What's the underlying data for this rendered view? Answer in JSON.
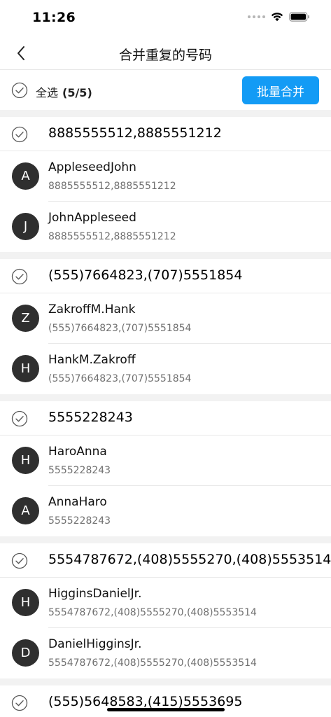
{
  "status": {
    "time": "11:26"
  },
  "nav": {
    "title": "合并重复的号码"
  },
  "select_all": {
    "label": "全选",
    "count": "(5/5)"
  },
  "merge_button": {
    "label": "批量合并"
  },
  "colors": {
    "accent": "#139bf5",
    "avatar": "#2f2f2f",
    "divider": "#e9e9e9",
    "section_gap": "#f2f2f2"
  },
  "groups": [
    {
      "number": "8885555512,8885551212",
      "contacts": [
        {
          "initial": "A",
          "name": "AppleseedJohn",
          "phones": "8885555512,8885551212"
        },
        {
          "initial": "J",
          "name": "JohnAppleseed",
          "phones": "8885555512,8885551212"
        }
      ]
    },
    {
      "number": "(555)7664823,(707)5551854",
      "contacts": [
        {
          "initial": "Z",
          "name": "ZakroffM.Hank",
          "phones": "(555)7664823,(707)5551854"
        },
        {
          "initial": "H",
          "name": "HankM.Zakroff",
          "phones": "(555)7664823,(707)5551854"
        }
      ]
    },
    {
      "number": "5555228243",
      "contacts": [
        {
          "initial": "H",
          "name": "HaroAnna",
          "phones": "5555228243"
        },
        {
          "initial": "A",
          "name": "AnnaHaro",
          "phones": "5555228243"
        }
      ]
    },
    {
      "number": "5554787672,(408)5555270,(408)5553514",
      "contacts": [
        {
          "initial": "H",
          "name": "HigginsDanielJr.",
          "phones": "5554787672,(408)5555270,(408)5553514"
        },
        {
          "initial": "D",
          "name": "DanielHigginsJr.",
          "phones": "5554787672,(408)5555270,(408)5553514"
        }
      ]
    },
    {
      "number": "(555)5648583,(415)5553695",
      "contacts": []
    }
  ]
}
